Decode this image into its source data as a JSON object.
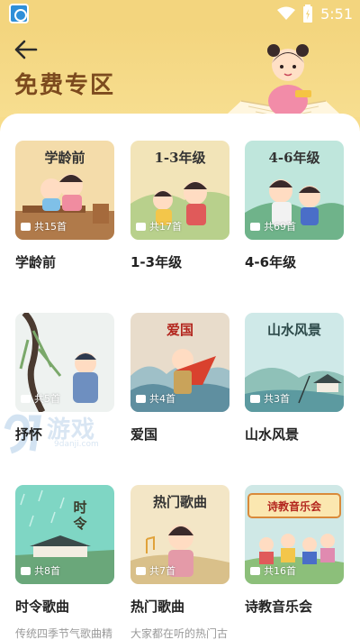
{
  "status": {
    "time": "5:51"
  },
  "header": {
    "title": "免费专区"
  },
  "watermark": {
    "text": "游戏",
    "sub": "9danji.com"
  },
  "cards": [
    {
      "thumb_title": "学龄前",
      "count": "共15首",
      "name": "学龄前",
      "desc": ""
    },
    {
      "thumb_title": "1-3年级",
      "count": "共17首",
      "name": "1-3年级",
      "desc": ""
    },
    {
      "thumb_title": "4-6年级",
      "count": "共69首",
      "name": "4-6年级",
      "desc": ""
    },
    {
      "thumb_title": "",
      "count": "共5首",
      "name": "抒怀",
      "desc": ""
    },
    {
      "thumb_title": "爱国",
      "count": "共4首",
      "name": "爱国",
      "desc": ""
    },
    {
      "thumb_title": "山水风景",
      "count": "共3首",
      "name": "山水风景",
      "desc": ""
    },
    {
      "thumb_title": "时令",
      "count": "共8首",
      "name": "时令歌曲",
      "desc": "传统四季节气歌曲精选"
    },
    {
      "thumb_title": "热门歌曲",
      "count": "共7首",
      "name": "热门歌曲",
      "desc": "大家都在听的热门古诗词歌曲"
    },
    {
      "thumb_title": "诗教音乐会",
      "count": "共16首",
      "name": "诗教音乐会",
      "desc": ""
    }
  ]
}
